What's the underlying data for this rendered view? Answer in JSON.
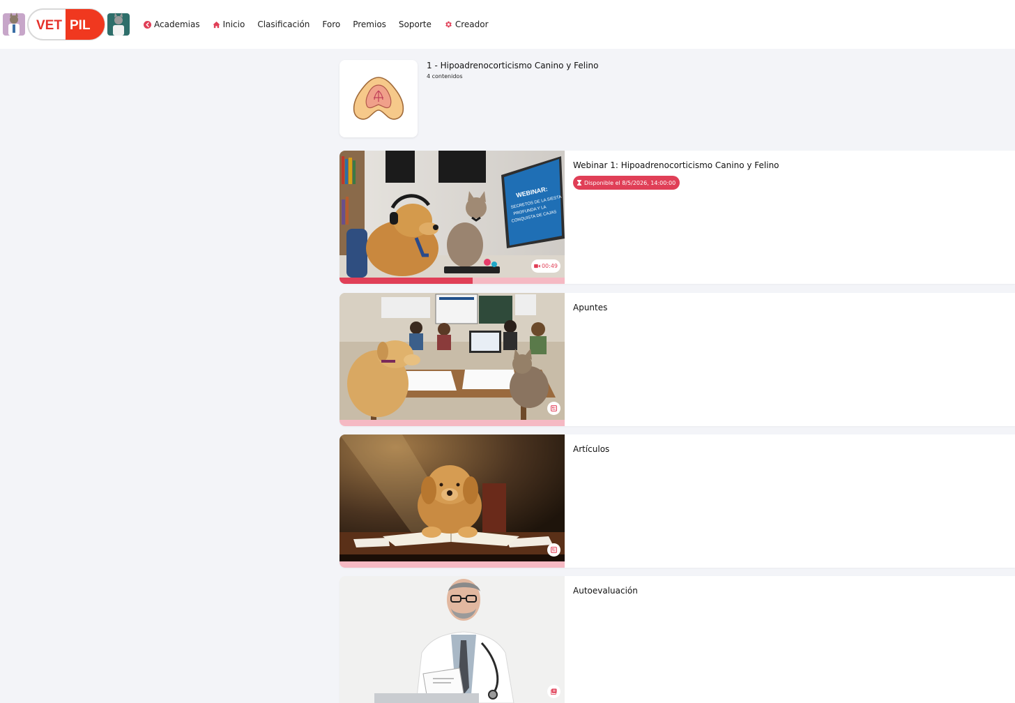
{
  "colors": {
    "accent": "#e03f57",
    "progress_track": "#f5b9c3",
    "background": "#f3f4f8"
  },
  "logo": {
    "text_left": "VET",
    "text_right": "PIL"
  },
  "nav": {
    "items": [
      {
        "label": "Academias",
        "icon": "arrow-left-circle-icon"
      },
      {
        "label": "Inicio",
        "icon": "home-icon"
      },
      {
        "label": "Clasificación",
        "icon": ""
      },
      {
        "label": "Foro",
        "icon": ""
      },
      {
        "label": "Premios",
        "icon": ""
      },
      {
        "label": "Soporte",
        "icon": ""
      },
      {
        "label": "Creador",
        "icon": "gear-icon"
      }
    ]
  },
  "module": {
    "title": "1 - Hipoadrenocorticismo Canino y Felino",
    "count": "4 contenidos",
    "thumbnail_icon": "adrenal-gland-illustration"
  },
  "contents": [
    {
      "title": "Webinar 1: Hipoadrenocorticismo Canino y Felino",
      "badge": "Disponible el 8/5/2026, 14:00:00",
      "media_type": "video-icon",
      "duration": "00:49",
      "progress": 0.59,
      "thumbnail": "dog-and-cat-at-webinar",
      "screen_text": "WEBINAR: SECRETOS DE LA SIESTA PROFUNDA Y LA CONQUISTA DE CAJAS"
    },
    {
      "title": "Apuntes",
      "media_type": "document-icon",
      "progress": 0,
      "thumbnail": "dog-and-cat-in-classroom"
    },
    {
      "title": "Artículos",
      "media_type": "document-icon",
      "progress": 0,
      "thumbnail": "puppy-reading-book"
    },
    {
      "title": "Autoevaluación",
      "media_type": "quiz-icon",
      "progress": 0,
      "thumbnail": "veterinarian-with-clipboard"
    }
  ]
}
